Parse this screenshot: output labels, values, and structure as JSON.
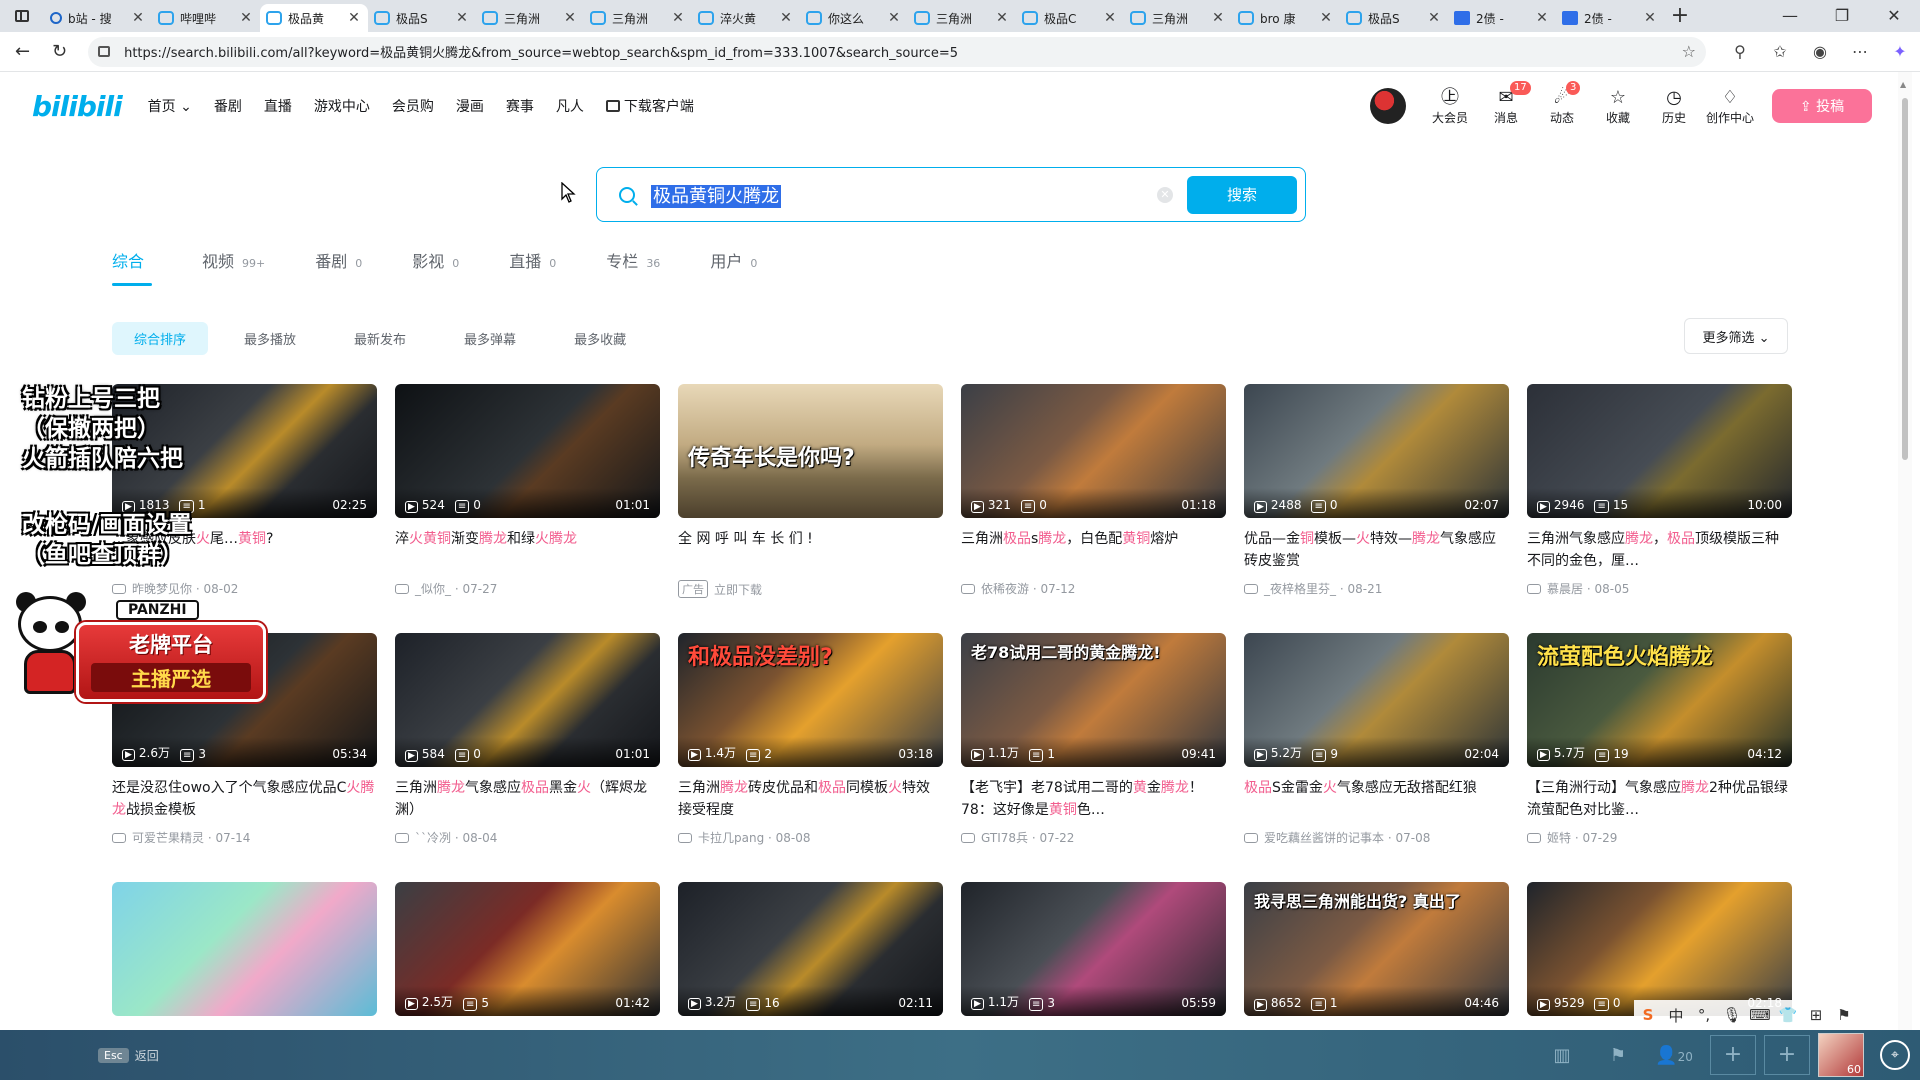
{
  "browser": {
    "tabs": [
      {
        "label": "b站 - 搜",
        "icon": "search",
        "active": false
      },
      {
        "label": "哔哩哔",
        "icon": "bili",
        "active": false
      },
      {
        "label": "极品黄",
        "icon": "bili",
        "active": true
      },
      {
        "label": "极品S",
        "icon": "bili",
        "active": false
      },
      {
        "label": "三角洲",
        "icon": "bili",
        "active": false
      },
      {
        "label": "三角洲",
        "icon": "bili",
        "active": false
      },
      {
        "label": "淬火黄",
        "icon": "bili",
        "active": false
      },
      {
        "label": "你这么",
        "icon": "bili",
        "active": false
      },
      {
        "label": "三角洲",
        "icon": "bili",
        "active": false
      },
      {
        "label": "极品C",
        "icon": "bili",
        "active": false
      },
      {
        "label": "三角洲",
        "icon": "bili",
        "active": false
      },
      {
        "label": "bro 康",
        "icon": "bili",
        "active": false
      },
      {
        "label": "极品S",
        "icon": "bili",
        "active": false
      },
      {
        "label": "2债 - ",
        "icon": "doc",
        "active": false
      },
      {
        "label": "2债 - ",
        "icon": "doc",
        "active": false
      }
    ],
    "url": "https://search.bilibili.com/all?keyword=极品黄铜火腾龙&from_source=webtop_search&spm_id_from=333.1007&search_source=5"
  },
  "header": {
    "logo": "bilibili",
    "nav": [
      "首页 ⌄",
      "番剧",
      "直播",
      "游戏中心",
      "会员购",
      "漫画",
      "赛事",
      "凡人",
      "下载客户端"
    ],
    "right": [
      {
        "label": "大会员",
        "icon": "vip-icon",
        "glyph": "㊤",
        "badge": ""
      },
      {
        "label": "消息",
        "icon": "message-icon",
        "glyph": "✉",
        "badge": "17"
      },
      {
        "label": "动态",
        "icon": "dynamic-icon",
        "glyph": "☄",
        "badge": "3"
      },
      {
        "label": "收藏",
        "icon": "favorite-icon",
        "glyph": "☆",
        "badge": ""
      },
      {
        "label": "历史",
        "icon": "history-icon",
        "glyph": "◷",
        "badge": ""
      },
      {
        "label": "创作中心",
        "icon": "creator-icon",
        "glyph": "♢",
        "badge": ""
      }
    ],
    "upload": "⇪ 投稿"
  },
  "search": {
    "query": "极品黄铜火腾龙",
    "button": "搜索"
  },
  "type_tabs": [
    {
      "label": "综合",
      "count": ""
    },
    {
      "label": "视频",
      "count": "99+"
    },
    {
      "label": "番剧",
      "count": "0"
    },
    {
      "label": "影视",
      "count": "0"
    },
    {
      "label": "直播",
      "count": "0"
    },
    {
      "label": "专栏",
      "count": "36"
    },
    {
      "label": "用户",
      "count": "0"
    }
  ],
  "sort": [
    "综合排序",
    "最多播放",
    "最新发布",
    "最多弹幕",
    "最多收藏"
  ],
  "more_filter": "更多筛选 ⌄",
  "videos": [
    {
      "bg": "gold",
      "plays": "1813",
      "danmaku": "1",
      "duration": "02:25",
      "title": "…象感应皮肤火尾…黄铜?",
      "author": "昨晚梦见你",
      "date": "08-02",
      "overlay": ""
    },
    {
      "bg": "dark",
      "plays": "524",
      "danmaku": "0",
      "duration": "01:01",
      "title": "淬火黄铜渐变腾龙和绿火腾龙",
      "author": "_似你_",
      "date": "07-27",
      "overlay": ""
    },
    {
      "bg": "tank",
      "plays": "",
      "danmaku": "",
      "duration": "",
      "title": "全 网 呼 叫 车 长 们 !",
      "author": "立即下载",
      "date": "",
      "overlay": "传奇车长是你吗?",
      "ad": "广告"
    },
    {
      "bg": "store",
      "plays": "321",
      "danmaku": "0",
      "duration": "01:18",
      "title": "三角洲极品s腾龙，白色配黄铜熔炉",
      "author": "依稀夜游",
      "date": "07-12",
      "overlay": ""
    },
    {
      "bg": "room",
      "plays": "2488",
      "danmaku": "0",
      "duration": "02:07",
      "title": "优品—金铜模板—火特效—腾龙气象感应砖皮鉴赏",
      "author": "_夜梓格里芬_",
      "date": "08-21",
      "overlay": ""
    },
    {
      "bg": "ui",
      "plays": "2946",
      "danmaku": "15",
      "duration": "10:00",
      "title": "三角洲气象感应腾龙，极品顶级模版三种不同的金色，厘…",
      "author": "慕晨居",
      "date": "08-05",
      "overlay": ""
    },
    {
      "bg": "dark",
      "plays": "2.6万",
      "danmaku": "3",
      "duration": "05:34",
      "title": "还是没忍住owo入了个气象感应优品C火腾龙战损金模板",
      "author": "可爱芒果精灵",
      "date": "07-14",
      "overlay": ""
    },
    {
      "bg": "gold",
      "plays": "584",
      "danmaku": "0",
      "duration": "01:01",
      "title": "三角洲腾龙气象感应极品黑金火（辉烬龙渊）",
      "author": "``冷冽",
      "date": "08-04",
      "overlay": ""
    },
    {
      "bg": "fire",
      "plays": "1.4万",
      "danmaku": "2",
      "duration": "03:18",
      "title": "三角洲腾龙砖皮优品和极品同模板火特效接受程度",
      "author": "卡拉几pang",
      "date": "08-08",
      "overlay": "和极品没差别?"
    },
    {
      "bg": "store",
      "plays": "1.1万",
      "danmaku": "1",
      "duration": "09:41",
      "title": "【老飞宇】老78试用二哥的黄金腾龙！78：这好像是黄铜色…",
      "author": "GTI78兵",
      "date": "07-22",
      "overlay": "老78试用二哥的黄金腾龙!"
    },
    {
      "bg": "room",
      "plays": "5.2万",
      "danmaku": "9",
      "duration": "02:04",
      "title": "极品S金雷金火气象感应无敌搭配红狼",
      "author": "爱吃藕丝酱饼的记事本",
      "date": "07-08",
      "overlay": ""
    },
    {
      "bg": "green",
      "plays": "5.7万",
      "danmaku": "19",
      "duration": "04:12",
      "title": "【三角洲行动】气象感应腾龙2种优品银绿流萤配色对比鉴…",
      "author": "姬特",
      "date": "07-29",
      "overlay": "流萤配色火焰腾龙"
    },
    {
      "bg": "anime",
      "plays": "",
      "danmaku": "",
      "duration": "",
      "title": "",
      "author": "",
      "date": "",
      "overlay": ""
    },
    {
      "bg": "red",
      "plays": "2.5万",
      "danmaku": "5",
      "duration": "01:42",
      "title": "",
      "author": "",
      "date": "",
      "overlay": ""
    },
    {
      "bg": "gold",
      "plays": "3.2万",
      "danmaku": "16",
      "duration": "02:11",
      "title": "",
      "author": "",
      "date": "",
      "overlay": ""
    },
    {
      "bg": "pink",
      "plays": "1.1万",
      "danmaku": "3",
      "duration": "05:59",
      "title": "",
      "author": "",
      "date": "",
      "overlay": ""
    },
    {
      "bg": "store",
      "plays": "8652",
      "danmaku": "1",
      "duration": "04:46",
      "title": "",
      "author": "",
      "date": "",
      "overlay": "我寻思三角洲能出货? 真出了"
    },
    {
      "bg": "fire",
      "plays": "9529",
      "danmaku": "0",
      "duration": "02:18",
      "title": "",
      "author": "",
      "date": "",
      "overlay": ""
    }
  ],
  "stream_overlay": {
    "lines1": [
      "钻粉上号三把",
      "（保撤两把）",
      "火箭插队陪六把"
    ],
    "lines2": [
      "改枪码/画面设置",
      "（鱼吧查顶群）"
    ],
    "panzhi_tag": "PANZHI",
    "plate1": "老牌平台",
    "plate2": "主播严选"
  },
  "taskbar": {
    "esc_key": "Esc",
    "esc_label": "返回",
    "players": "20",
    "level": "60"
  },
  "ime": [
    "S",
    "中",
    "°,",
    "🎙",
    "⌨",
    "👕",
    "⊞",
    "⚑"
  ]
}
